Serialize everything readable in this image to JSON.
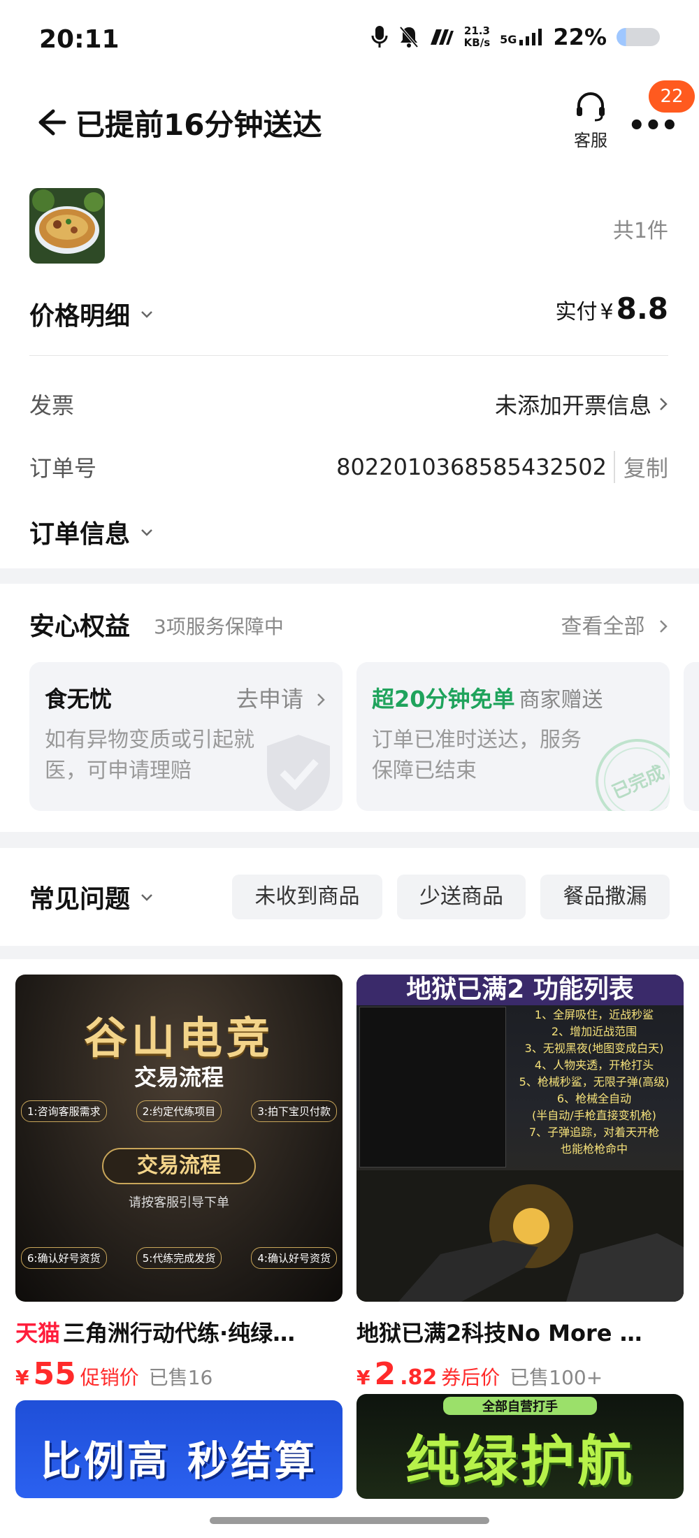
{
  "status": {
    "time": "20:11",
    "speed_top": "21.3",
    "speed_bottom": "KB/s",
    "network": "5G",
    "battery_pct": "22%"
  },
  "header": {
    "title": "已提前16分钟送达",
    "cs_label": "客服",
    "badge_count": "22"
  },
  "order": {
    "item_count": "共1件",
    "price_detail_label": "价格明细",
    "pay_label": "实付",
    "pay_currency": "¥",
    "pay_amount": "8.8",
    "invoice_label": "发票",
    "invoice_value": "未添加开票信息",
    "order_no_label": "订单号",
    "order_no": "8022010368585432502",
    "copy_label": "复制",
    "order_info_label": "订单信息"
  },
  "benefits": {
    "title": "安心权益",
    "subtitle": "3项服务保障中",
    "view_all": "查看全部",
    "cards": [
      {
        "title": "食无忧",
        "action": "去申请",
        "desc": "如有异物变质或引起就医，可申请理赔"
      },
      {
        "title": "超20分钟免单",
        "tag": "商家赠送",
        "desc": "订单已准时送达，服务保障已结束",
        "stamp": "已完成"
      }
    ]
  },
  "faq": {
    "title": "常见问题",
    "chips": [
      "未收到商品",
      "少送商品",
      "餐品撒漏"
    ]
  },
  "products": [
    {
      "brand": "天猫",
      "title": "三角洲行动代练·纯绿…",
      "currency": "¥",
      "price": "55",
      "price_dec": "",
      "tag": "促销价",
      "sold": "已售16",
      "img_title": "谷山电竞",
      "img_sub": "交易流程",
      "img_btn": "交易流程",
      "img_note": "请按客服引导下单",
      "img_steps": [
        "1:咨询客服需求",
        "2:约定代练项目",
        "3:拍下宝贝付款",
        "6:确认好号资货",
        "5:代练完成发货",
        "4:确认好号资货"
      ]
    },
    {
      "brand": "",
      "title": "地狱已满2科技No More …",
      "currency": "¥",
      "price": "2",
      "price_dec": ".82",
      "tag": "券后价",
      "sold": "已售100+",
      "img_title": "地狱已满2 功能列表",
      "img_lines": [
        "1、全屏吸住，近战秒鲨",
        "2、增加近战范围",
        "3、无视黑夜(地图变成白天)",
        "4、人物夹透，开枪打头",
        "5、枪械秒鲨，无限子弹(高级)",
        "6、枪械全自动",
        "(半自动/手枪直接变机枪)",
        "7、子弹追踪，对着天开枪",
        "也能枪枪命中"
      ]
    },
    {
      "brand": "",
      "img_title": "比例高 秒结算"
    },
    {
      "brand": "",
      "img_title": "纯绿护航",
      "img_top": "全部自营打手"
    }
  ]
}
